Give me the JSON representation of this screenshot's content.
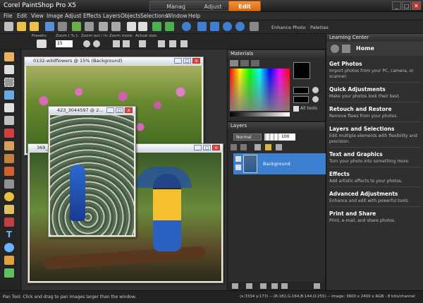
{
  "titlebar": {
    "app_title": "Corel PaintShop Pro X5",
    "tabs": [
      {
        "label": "Manage"
      },
      {
        "label": "Adjust"
      },
      {
        "label": "Edit"
      }
    ],
    "window_controls": {
      "minimize": "_",
      "maximize": "□",
      "close": "✕"
    }
  },
  "menubar": {
    "items": [
      "File",
      "Edit",
      "View",
      "Image",
      "Adjust",
      "Effects",
      "Layers",
      "Objects",
      "Selections",
      "Window",
      "Help"
    ]
  },
  "toolbar": {
    "enhance_photo": "Enhance Photo",
    "palettes": "Palettes"
  },
  "options": {
    "presets": "Presets:",
    "zoom_pct": "Zoom ( % ):",
    "zoom_out_in": "Zoom out / in:",
    "zoom_more": "Zoom more:",
    "actual_size": "Actual size:",
    "zoom_value": "15"
  },
  "documents": [
    {
      "title": "0132-wildflowers @ 15% (Background)"
    },
    {
      "title": "423_3044597 @ 2..."
    },
    {
      "title": "369_..."
    }
  ],
  "materials": {
    "title": "Materials",
    "all_tools": "All tools"
  },
  "layers": {
    "title": "Layers",
    "blend_mode": "Normal",
    "opacity": "100",
    "items": [
      {
        "name": "Background"
      }
    ]
  },
  "learning_center": {
    "panel_title": "Learning Center",
    "home": "Home",
    "items": [
      {
        "title": "Get Photos",
        "desc": "Import photos from your PC, camera, or scanner."
      },
      {
        "title": "Quick Adjustments",
        "desc": "Make your photos look their best."
      },
      {
        "title": "Retouch and Restore",
        "desc": "Remove flaws from your photos."
      },
      {
        "title": "Layers and Selections",
        "desc": "Edit multiple elements with flexibility and precision."
      },
      {
        "title": "Text and Graphics",
        "desc": "Turn your photo into something more."
      },
      {
        "title": "Effects",
        "desc": "Add artistic effects to your photos."
      },
      {
        "title": "Advanced Adjustments",
        "desc": "Enhance and edit with powerful tools."
      },
      {
        "title": "Print and Share",
        "desc": "Print, e-mail, and share photos."
      }
    ]
  },
  "status": {
    "hint": "Pan Tool: Click and drag to pan images larger than the window.",
    "info": "(x:3334 y:173) -- (R:182,G:164,B:144,O:255) -- Image: 3600 x 2400 x RGB - 8 bits/channel"
  },
  "colors": {
    "accent": "#e87b1e",
    "selection": "#3d7fd1"
  }
}
